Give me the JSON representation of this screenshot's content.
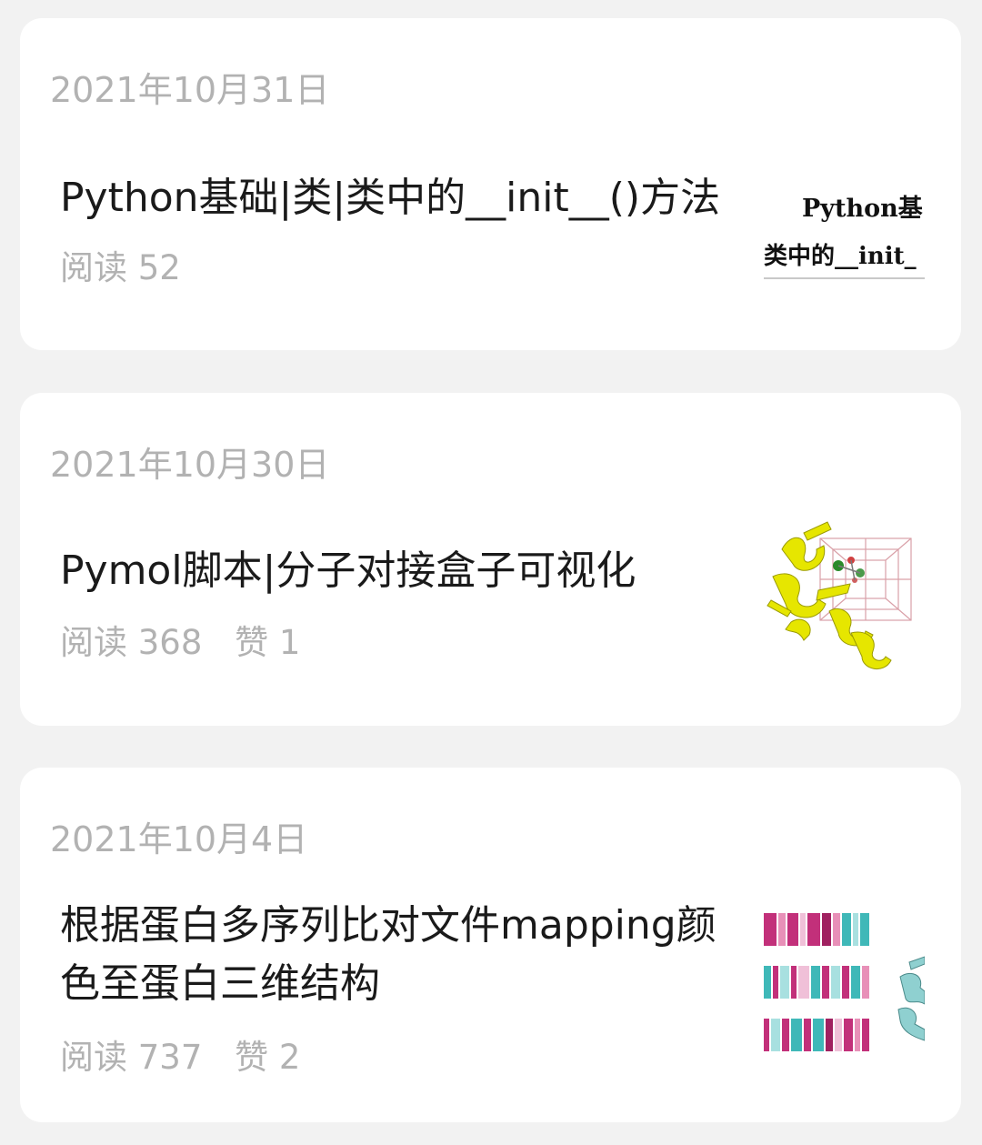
{
  "articles": [
    {
      "date": "2021年10月31日",
      "title": "Python基础|类|类中的__init__()方法",
      "reads": "阅读 52",
      "likes": "",
      "thumb": {
        "line1": "Python基",
        "line2": "类中的__init_"
      }
    },
    {
      "date": "2021年10月30日",
      "title": "Pymol脚本|分子对接盒子可视化",
      "reads": "阅读 368",
      "likes": "赞 1"
    },
    {
      "date": "2021年10月4日",
      "title": "根据蛋白多序列比对文件mapping颜色至蛋白三维结构",
      "reads": "阅读 737",
      "likes": "赞 2"
    }
  ],
  "colors": {
    "background": "#f2f2f2",
    "card": "#ffffff",
    "date_text": "#b2b2b2",
    "title_text": "#1a1a1a",
    "protein_yellow": "#e6e600",
    "alignment_magenta": "#c2307a",
    "alignment_teal": "#3fb8b8"
  }
}
